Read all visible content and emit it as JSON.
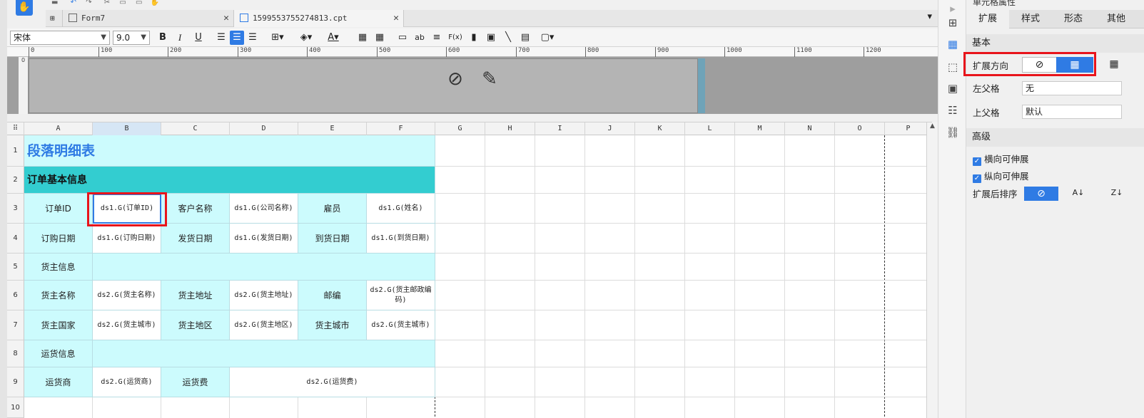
{
  "tabs": [
    {
      "label": "Form7"
    },
    {
      "label": "1599553755274813.cpt"
    }
  ],
  "toolbar": {
    "font_name": "宋体",
    "font_size": "9.0",
    "bold": "B",
    "italic": "I",
    "underline": "U",
    "formula": "F(x)",
    "ab": "ab"
  },
  "ruler_ticks": [
    "0",
    "100",
    "200",
    "300",
    "400",
    "500",
    "600",
    "700",
    "800",
    "900",
    "1000",
    "1100",
    "1200"
  ],
  "columns": [
    "A",
    "B",
    "C",
    "D",
    "E",
    "F",
    "G",
    "H",
    "I",
    "J",
    "K",
    "L",
    "M",
    "N",
    "O",
    "P"
  ],
  "rows": [
    "1",
    "2",
    "3",
    "4",
    "5",
    "6",
    "7",
    "8",
    "9",
    "10"
  ],
  "report": {
    "title": "段落明细表",
    "section1": "订单基本信息",
    "r3": [
      "订单ID",
      "ds1.G(订单ID)",
      "客户名称",
      "ds1.G(公司名称)",
      "雇员",
      "ds1.G(姓名)"
    ],
    "r4": [
      "订购日期",
      "ds1.G(订购日期)",
      "发货日期",
      "ds1.G(发货日期)",
      "到货日期",
      "ds1.G(到货日期)"
    ],
    "r5": "货主信息",
    "r6": [
      "货主名称",
      "ds2.G(货主名称)",
      "货主地址",
      "ds2.G(货主地址)",
      "邮编",
      "ds2.G(货主邮政编码)"
    ],
    "r7": [
      "货主国家",
      "ds2.G(货主城市)",
      "货主地区",
      "ds2.G(货主地区)",
      "货主城市",
      "ds2.G(货主城市)"
    ],
    "r8": "运货信息",
    "r9": [
      "运货商",
      "ds2.G(运货商)",
      "运货费",
      "ds2.G(运货费)"
    ]
  },
  "props": {
    "header": "单元格属性",
    "tabs": [
      "扩展",
      "样式",
      "形态",
      "其他"
    ],
    "basic": "基本",
    "expand_dir": "扩展方向",
    "left_parent": "左父格",
    "left_parent_value": "无",
    "top_parent": "上父格",
    "top_parent_value": "默认",
    "advanced": "高级",
    "h_expand": "横向可伸展",
    "v_expand": "纵向可伸展",
    "sort_after": "扩展后排序"
  },
  "colors": {
    "accent": "#2f7be4",
    "cyan": "#ccfbfd",
    "teal": "#33cdd0",
    "highlight": "#e8141b",
    "title": "#2f7be4"
  }
}
